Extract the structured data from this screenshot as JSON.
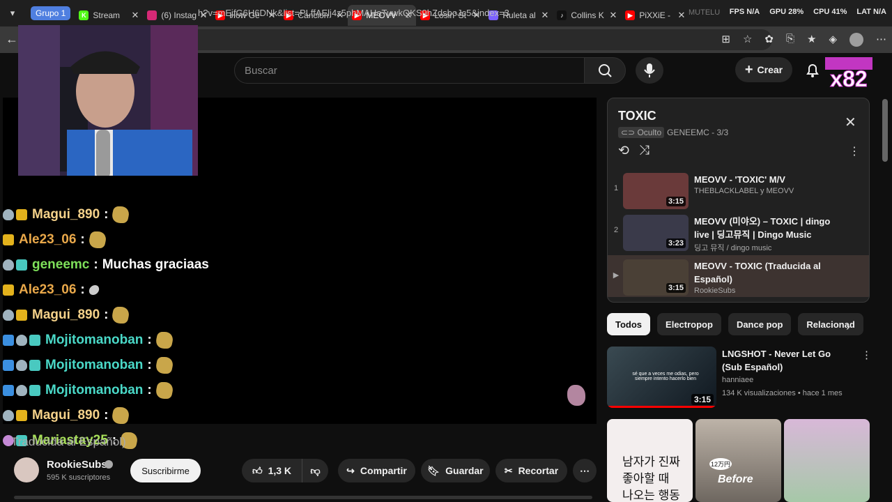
{
  "browser": {
    "group_label": "Grupo 1",
    "tabs": [
      {
        "title": "Stream",
        "color": "#53fc18",
        "glyph": "K"
      },
      {
        "title": "(6) Instag",
        "color": "#d62976",
        "glyph": ""
      },
      {
        "title": "How Ge",
        "color": "#ff0000",
        "glyph": "▶"
      },
      {
        "title": "Cancion",
        "color": "#ff0000",
        "glyph": "▶"
      },
      {
        "title": "MEOVV",
        "color": "#ff0000",
        "glyph": "▶",
        "active": true
      },
      {
        "title": "Losin' St",
        "color": "#ff0000",
        "glyph": "▶"
      },
      {
        "title": "Ruleta al",
        "color": "#7b61ff",
        "glyph": ""
      },
      {
        "title": "Collins K",
        "color": "#111111",
        "glyph": "♪"
      },
      {
        "title": "PiXXiE - ",
        "color": "#ff0000",
        "glyph": "▶"
      }
    ],
    "ghost_tab": "MUTELU",
    "stats": {
      "fps": "FPS N/A",
      "gpu": "GPU 28%",
      "cpu": "CPU 41%",
      "lat": "LAT N/A"
    },
    "url": "h?v=mEjfG6H6DNk&list=PLffAElj4z5phMAHaTuwkQKS9hZdsboJc5&index=3"
  },
  "header": {
    "search_placeholder": "Buscar",
    "create_label": "Crear",
    "logo_text": "x82"
  },
  "chat": [
    {
      "badges": [
        "shield",
        "crown"
      ],
      "user": "Magui_890",
      "color": "#f5d28a",
      "emote": "butterfly"
    },
    {
      "badges": [
        "crown"
      ],
      "user": "Ale23_06",
      "color": "#e9a84a",
      "emote": "butterfly"
    },
    {
      "badges": [
        "shield",
        "cg"
      ],
      "user": "geneemc",
      "color": "#7ee05a",
      "msg": "Muchas graciaas"
    },
    {
      "badges": [
        "crown"
      ],
      "user": "Ale23_06",
      "color": "#e9a84a",
      "emote": "small"
    },
    {
      "badges": [
        "shield",
        "crown"
      ],
      "user": "Magui_890",
      "color": "#f5d28a",
      "emote": "butterfly"
    },
    {
      "badges": [
        "blue",
        "shield",
        "cg"
      ],
      "user": "Mojitomanoban",
      "color": "#4ad9c8",
      "emote": "butterfly"
    },
    {
      "badges": [
        "blue",
        "shield",
        "cg"
      ],
      "user": "Mojitomanoban",
      "color": "#4ad9c8",
      "emote": "butterfly"
    },
    {
      "badges": [
        "blue",
        "shield",
        "cg"
      ],
      "user": "Mojitomanoban",
      "color": "#4ad9c8",
      "emote": "butterfly"
    },
    {
      "badges": [
        "shield",
        "crown"
      ],
      "user": "Magui_890",
      "color": "#f5d28a",
      "emote": "butterfly"
    },
    {
      "badges": [
        "heart",
        "cg"
      ],
      "user": "Mariastay25",
      "color": "#a8e05a",
      "emote": "butterfly"
    }
  ],
  "video_title_ghost": "Traducida al Español)",
  "channel": {
    "name": "RookieSubs",
    "subs": "595 K suscriptores",
    "subscribe_label": "Suscribirme"
  },
  "actions": {
    "likes": "1,3 K",
    "share": "Compartir",
    "save": "Guardar",
    "clip": "Recortar"
  },
  "playlist": {
    "title": "TOXIC",
    "privacy": "Oculto",
    "owner_progress": "GENEEMC - 3/3",
    "items": [
      {
        "index": "1",
        "title": "MEOVV - 'TOXIC' M/V",
        "channel": "THEBLACKLABEL y MEOVV",
        "duration": "3:15",
        "thumb": "#6a3a3a"
      },
      {
        "index": "2",
        "title": "MEOVV (미야오) – TOXIC | dingo live | 딩고뮤직 | Dingo Music",
        "channel": "딩고 뮤직 / dingo music",
        "duration": "3:23",
        "thumb": "#3a3a4a"
      },
      {
        "index": "▶",
        "title": "MEOVV - TOXIC (Traducida al Español)",
        "channel": "RookieSubs",
        "duration": "3:15",
        "thumb": "#4a4036",
        "current": true
      }
    ]
  },
  "chips": [
    "Todos",
    "Electropop",
    "Dance pop",
    "Relacionad"
  ],
  "recommendation": {
    "title": "LNGSHOT - Never Let Go (Sub Español)",
    "channel": "hanniaee",
    "stats": "134 K visualizaciones • hace 1 mes",
    "duration": "3:15",
    "caption": "sé que a veces me odias, pero siempre intento hacerlo bien"
  },
  "shorts": {
    "s1_line1": "남자가 진짜",
    "s1_line2": "좋아할 때",
    "s1_line3": "나오는 행동",
    "s2_word": "Before",
    "s2_price": "12万円"
  }
}
